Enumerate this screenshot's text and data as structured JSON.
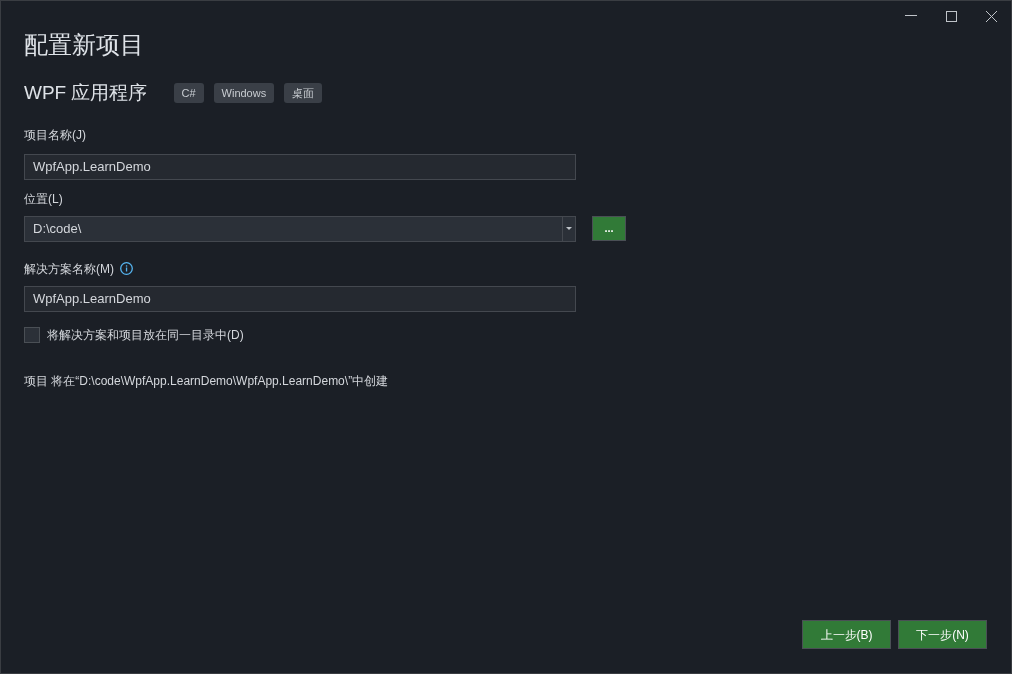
{
  "title": "配置新项目",
  "template": {
    "name": "WPF 应用程序",
    "tags": [
      "C#",
      "Windows",
      "桌面"
    ]
  },
  "project_name": {
    "label": "项目名称(J)",
    "value": "WpfApp.LearnDemo"
  },
  "location": {
    "label": "位置(L)",
    "value": "D:\\code\\",
    "browse_button": "..."
  },
  "solution_name": {
    "label": "解决方案名称(M)",
    "value": "WpfApp.LearnDemo"
  },
  "same_directory": {
    "label": "将解决方案和项目放在同一目录中(D)",
    "checked": false
  },
  "path_note": "项目 将在“D:\\code\\WpfApp.LearnDemo\\WpfApp.LearnDemo\\”中创建",
  "buttons": [
    "上一步(B)",
    "下一步(N)"
  ]
}
